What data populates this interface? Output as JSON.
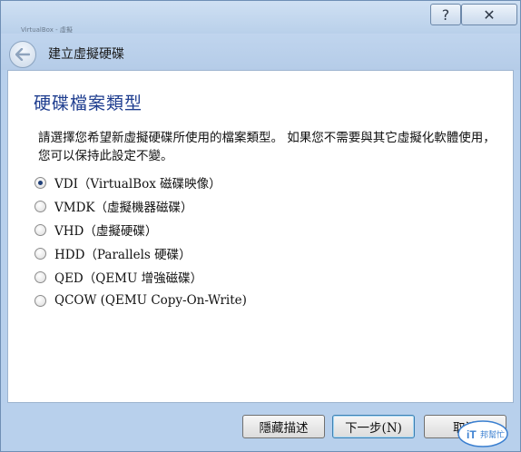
{
  "window": {
    "caption_hint": "VirtualBox - 虛擬",
    "help_glyph": "?",
    "close_glyph": "✕"
  },
  "nav": {
    "title": "建立虛擬硬碟",
    "back_icon": "back-arrow-icon"
  },
  "page": {
    "title": "硬碟檔案類型",
    "description": "請選擇您希望新虛擬硬碟所使用的檔案類型。 如果您不需要與其它虛擬化軟體使用，您可以保持此設定不變。"
  },
  "options": [
    {
      "label": "VDI（VirtualBox 磁碟映像）",
      "checked": true
    },
    {
      "label": "VMDK（虛擬機器磁碟）",
      "checked": false
    },
    {
      "label": "VHD（虛擬硬碟）",
      "checked": false
    },
    {
      "label": "HDD（Parallels 硬碟）",
      "checked": false
    },
    {
      "label": "QED（QEMU 增強磁碟）",
      "checked": false
    },
    {
      "label": "QCOW (QEMU Copy-On-Write)",
      "checked": false
    }
  ],
  "buttons": {
    "hide_description": "隱藏描述",
    "next": "下一步(N)",
    "cancel": "取消"
  },
  "watermark": {
    "text": "iT邦幫忙",
    "color": "#3a7fd0"
  }
}
